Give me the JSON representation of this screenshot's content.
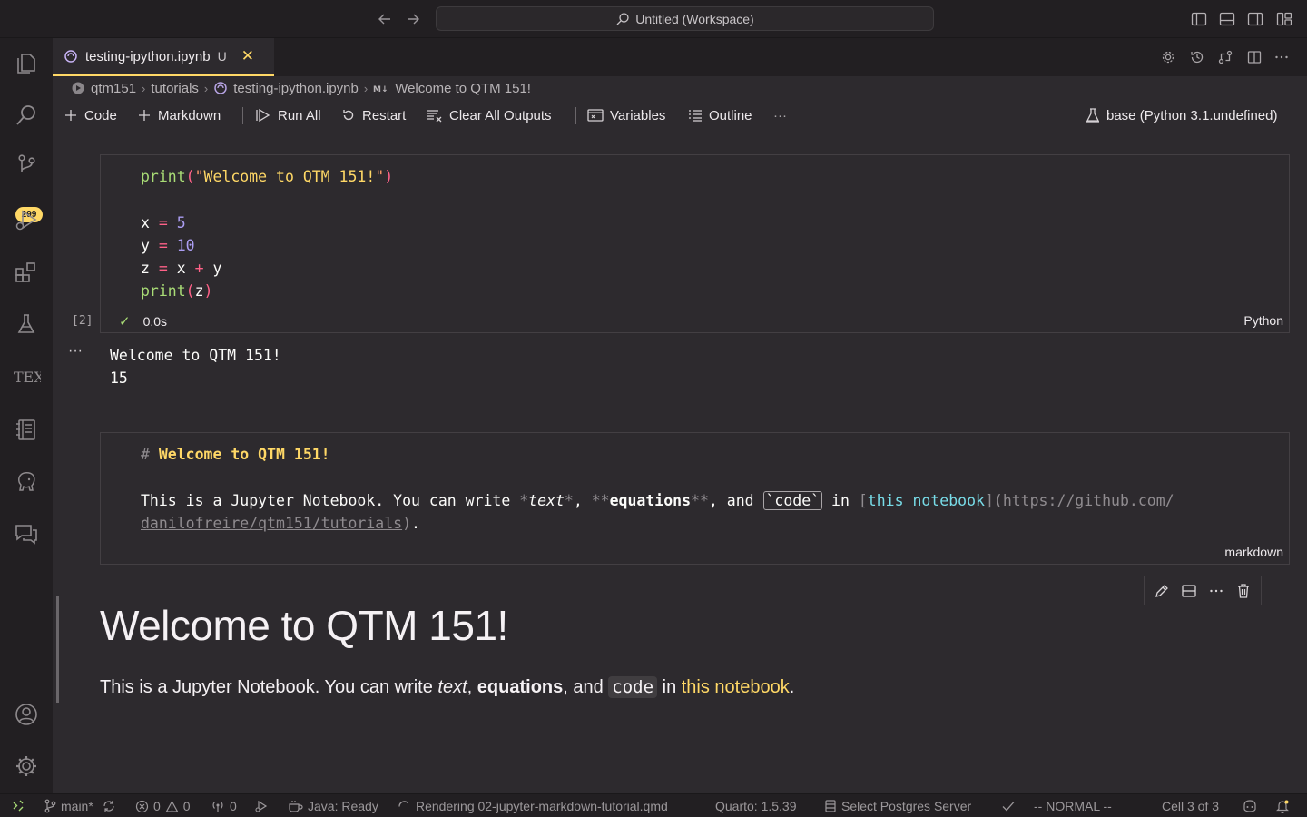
{
  "titlebar": {
    "search_text": "Untitled (Workspace)",
    "icons": [
      "back-arrow-icon",
      "forward-arrow-icon",
      "search-icon",
      "toggle-primary-sidebar-icon",
      "toggle-panel-icon",
      "toggle-secondary-sidebar-icon",
      "customize-layout-icon"
    ]
  },
  "activity_bar": {
    "items": [
      "explorer",
      "search",
      "source-control",
      "run-and-debug",
      "extensions",
      "testing",
      "tex",
      "notebook",
      "postgres",
      "chat"
    ],
    "scm_badge": "299",
    "bottom_items": [
      "accounts",
      "manage"
    ]
  },
  "tab": {
    "label": "testing-ipython.ipynb",
    "dirty_marker": "U",
    "close_glyph": "✕"
  },
  "breadcrumbs": [
    "qtm151",
    "tutorials",
    "testing-ipython.ipynb",
    "Welcome to QTM 151!"
  ],
  "breadcrumb_sep": "›",
  "notebook_toolbar": {
    "code": "Code",
    "markdown": "Markdown",
    "run_all": "Run All",
    "restart": "Restart",
    "clear_outputs": "Clear All Outputs",
    "variables": "Variables",
    "outline": "Outline",
    "more": "···",
    "kernel": "base (Python 3.1.undefined)"
  },
  "code_cell": {
    "execution_count": "[2]",
    "status_check": "✓",
    "duration": "0.0s",
    "language": "Python",
    "output_more": "···",
    "output_lines": [
      "Welcome to QTM 151!",
      "15"
    ]
  },
  "markdown_cell": {
    "language": "markdown",
    "source_heading": "Welcome to QTM 151!",
    "url_line2": "danilofreire/qtm151/tutorials"
  },
  "rendered": {
    "heading": "Welcome to QTM 151!",
    "p_prefix": "This is a Jupyter Notebook. You can write ",
    "p_text": "text",
    "p_comma": ", ",
    "p_equations": "equations",
    "p_and": ", and ",
    "p_code": "code",
    "p_in": " in ",
    "p_link": "this notebook",
    "p_end": "."
  },
  "statusbar": {
    "branch": "main*",
    "errors": "0",
    "warnings": "0",
    "ports": "0",
    "java": "Java: Ready",
    "rendering": "Rendering 02-jupyter-markdown-tutorial.qmd",
    "quarto": "Quarto: 1.5.39",
    "postgres": "Select Postgres Server",
    "vim_mode": "-- NORMAL --",
    "cell_position": "Cell 3 of 3"
  },
  "colors": {
    "accent": "#ffd866",
    "background": "#2d2a2e",
    "chrome": "#221f22",
    "string": "#ffd866",
    "function": "#a9dc76",
    "number": "#ab9df2",
    "operator": "#ff6188",
    "link": "#78dce8"
  }
}
